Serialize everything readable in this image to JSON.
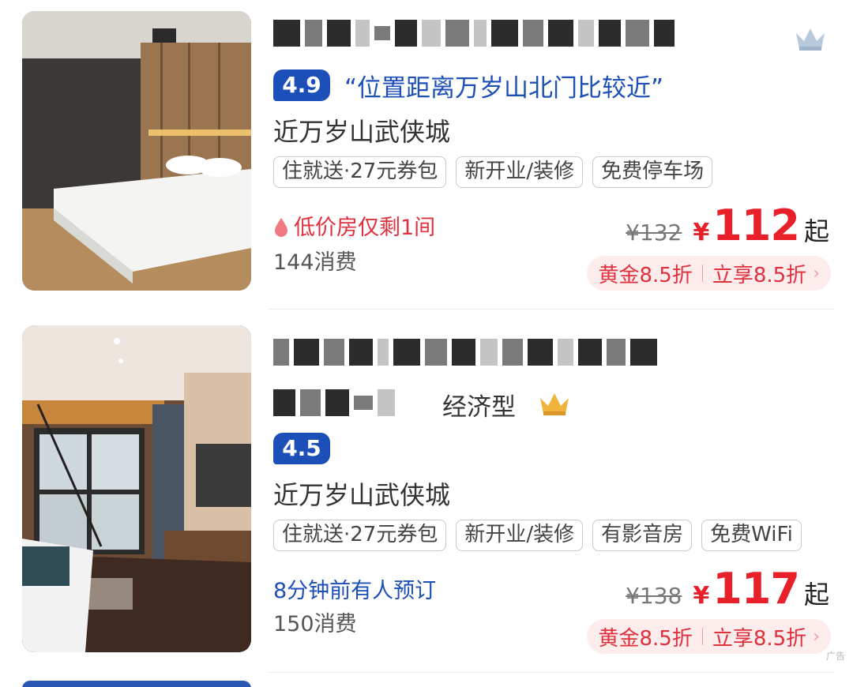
{
  "hotels": [
    {
      "name_hidden": true,
      "rating": "4.9",
      "review_quote": "“位置距离万岁山北门比较近”",
      "location": "近万岁山武侠城",
      "tags": [
        "住就送·27元券包",
        "新开业/装修",
        "免费停车场"
      ],
      "status_text": "低价房仅剩1间",
      "consumption": "144消费",
      "original_price": "¥132",
      "price_symbol": "¥",
      "price": "112",
      "price_suffix": "起",
      "promo": {
        "left": "黄金8.5折",
        "right": "立享8.5折"
      },
      "icons": {
        "badge": "crown-icon",
        "status": "fire-drop-icon"
      }
    },
    {
      "name_hidden": true,
      "hotel_type": "经济型",
      "rating": "4.5",
      "location": "近万岁山武侠城",
      "tags": [
        "住就送·27元券包",
        "新开业/装修",
        "有影音房",
        "免费WiFi"
      ],
      "status_text": "8分钟前有人预订",
      "consumption": "150消费",
      "original_price": "¥138",
      "price_symbol": "¥",
      "price": "117",
      "price_suffix": "起",
      "promo": {
        "left": "黄金8.5折",
        "right": "立享8.5折"
      },
      "ad_label": "广告",
      "icons": {
        "badge": "gold-crown-icon"
      }
    }
  ],
  "colors": {
    "rating_blue": "#1d4fb8",
    "price_red": "#e8202a",
    "promo_bg": "#fdecec",
    "crown_silver": "#b8c9dc",
    "crown_gold": "#f0b43c"
  }
}
